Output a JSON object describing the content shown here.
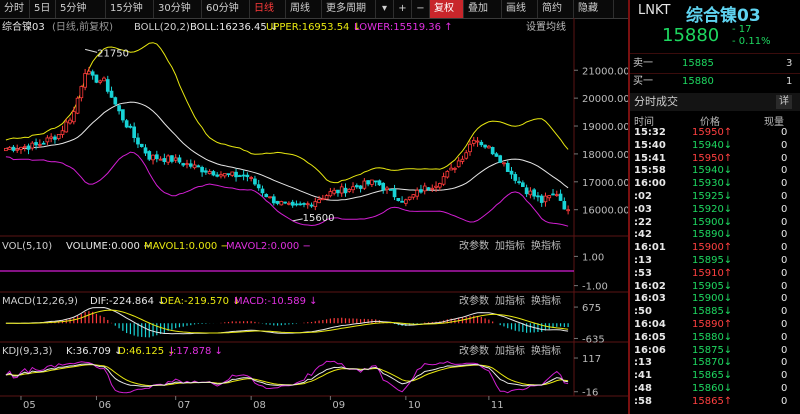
{
  "toolbar": {
    "tabs": [
      "分时",
      "5日",
      "5分钟",
      "15分钟",
      "30分钟",
      "60分钟",
      "日线",
      "周线",
      "更多周期"
    ],
    "active_tab": "日线",
    "icons_row": [
      "+",
      "−",
      "复权",
      "叠加",
      "画线",
      "简约",
      "隐藏"
    ]
  },
  "header": {
    "symbol_label": "综合镍03",
    "period_note": "(日线,前复权)",
    "indicator": "BOLL(20,2)",
    "boll_mid": "BOLL:16236.45 ↓",
    "boll_upper": "UPPER:16953.54 ↓",
    "boll_lower": "LOWER:15519.36 ↑",
    "settings": "设置均线"
  },
  "colors": {
    "up": "#ff3b3b",
    "down": "#18d3d6",
    "mid": "#e6e6e6",
    "upper": "#e8e810",
    "lower": "#d21ed2",
    "toolbar_red": "#c8262b"
  },
  "right": {
    "code": "LNKT",
    "name": "综合镍03",
    "price": "15880",
    "change": "- 17",
    "change_pct": "- 0.11%",
    "ask_label": "卖一",
    "ask_price": "15885",
    "ask_vol": "3",
    "bid_label": "买一",
    "bid_price": "15880",
    "bid_vol": "1",
    "section": "分时成交",
    "detail": "详",
    "col_time": "时间",
    "col_price": "价格",
    "col_vol": "现量",
    "trades": [
      {
        "t": "15:32",
        "p": "15950↑",
        "v": "0",
        "dir": "up"
      },
      {
        "t": "15:40",
        "p": "15940↓",
        "v": "0",
        "dir": "dn"
      },
      {
        "t": "15:41",
        "p": "15950↑",
        "v": "0",
        "dir": "up"
      },
      {
        "t": "15:58",
        "p": "15940↓",
        "v": "0",
        "dir": "dn"
      },
      {
        "t": "16:00",
        "p": "15930↓",
        "v": "0",
        "dir": "dn"
      },
      {
        "t": ":02",
        "p": "15925↓",
        "v": "0",
        "dir": "dn"
      },
      {
        "t": ":03",
        "p": "15920↓",
        "v": "0",
        "dir": "dn"
      },
      {
        "t": ":22",
        "p": "15900↓",
        "v": "0",
        "dir": "dn"
      },
      {
        "t": ":42",
        "p": "15890↓",
        "v": "0",
        "dir": "dn"
      },
      {
        "t": "16:01",
        "p": "15900↑",
        "v": "0",
        "dir": "up"
      },
      {
        "t": ":13",
        "p": "15895↓",
        "v": "0",
        "dir": "dn"
      },
      {
        "t": ":53",
        "p": "15910↑",
        "v": "0",
        "dir": "up"
      },
      {
        "t": "16:02",
        "p": "15905↓",
        "v": "0",
        "dir": "dn"
      },
      {
        "t": "16:03",
        "p": "15900↓",
        "v": "0",
        "dir": "dn"
      },
      {
        "t": ":50",
        "p": "15885↓",
        "v": "0",
        "dir": "dn"
      },
      {
        "t": "16:04",
        "p": "15890↑",
        "v": "0",
        "dir": "up"
      },
      {
        "t": "16:05",
        "p": "15880↓",
        "v": "0",
        "dir": "dn"
      },
      {
        "t": "16:06",
        "p": "15875↓",
        "v": "0",
        "dir": "dn"
      },
      {
        "t": ":13",
        "p": "15870↓",
        "v": "0",
        "dir": "dn"
      },
      {
        "t": ":41",
        "p": "15865↓",
        "v": "0",
        "dir": "dn"
      },
      {
        "t": ":48",
        "p": "15860↓",
        "v": "0",
        "dir": "dn"
      },
      {
        "t": ":58",
        "p": "15865↑",
        "v": "0",
        "dir": "up"
      }
    ]
  },
  "vol": {
    "label": "VOL(5,10)",
    "volume": "VOLUME:0.000 −",
    "mavol1": "MAVOL1:0.000 −",
    "mavol2": "MAVOL2:0.000 −"
  },
  "macd": {
    "label": "MACD(12,26,9)",
    "dif": "DIF:-224.864 ↓",
    "dea": "DEA:-219.570 ↓",
    "macd": "MACD:-10.589 ↓"
  },
  "kdj": {
    "label": "KDJ(9,3,3)",
    "k": "K:36.709 ↓",
    "d": "D:46.125 ↓",
    "j": "J:17.878 ↓"
  },
  "panel_buttons": [
    "改参数",
    "加指标",
    "换指标"
  ],
  "chart_data": [
    {
      "type": "candlestick",
      "title": "综合镍03 (日线,前复权)",
      "y_ticks": [
        16000,
        17000,
        18000,
        19000,
        20000,
        21000
      ],
      "ylim": [
        15200,
        22300
      ],
      "x_ticks": [
        "05",
        "06",
        "07",
        "08",
        "09",
        "10",
        "11"
      ],
      "annotations": [
        {
          "text": "21750",
          "value": 21750
        },
        {
          "text": "15600",
          "value": 15600
        }
      ],
      "series": [
        {
          "name": "BOLL",
          "value": 16236.45
        },
        {
          "name": "UPPER",
          "value": 16953.54
        },
        {
          "name": "LOWER",
          "value": 15519.36
        }
      ]
    },
    {
      "type": "bar",
      "title": "VOL(5,10)",
      "y_ticks": [
        "1.00",
        "-1.00"
      ],
      "ylim": [
        -1.3,
        1.3
      ],
      "series": [
        {
          "name": "VOLUME",
          "value": 0
        },
        {
          "name": "MAVOL1",
          "value": 0
        },
        {
          "name": "MAVOL2",
          "value": 0
        }
      ]
    },
    {
      "type": "line",
      "title": "MACD(12,26,9)",
      "y_ticks": [
        "675",
        "-635"
      ],
      "ylim": [
        -700,
        720
      ],
      "series": [
        {
          "name": "DIF",
          "value": -224.864
        },
        {
          "name": "DEA",
          "value": -219.57
        },
        {
          "name": "MACD",
          "value": -10.589
        }
      ]
    },
    {
      "type": "line",
      "title": "KDJ(9,3,3)",
      "y_ticks": [
        "117",
        "-16"
      ],
      "ylim": [
        -25,
        125
      ],
      "series": [
        {
          "name": "K",
          "value": 36.709
        },
        {
          "name": "D",
          "value": 46.125
        },
        {
          "name": "J",
          "value": 17.878
        }
      ]
    }
  ]
}
